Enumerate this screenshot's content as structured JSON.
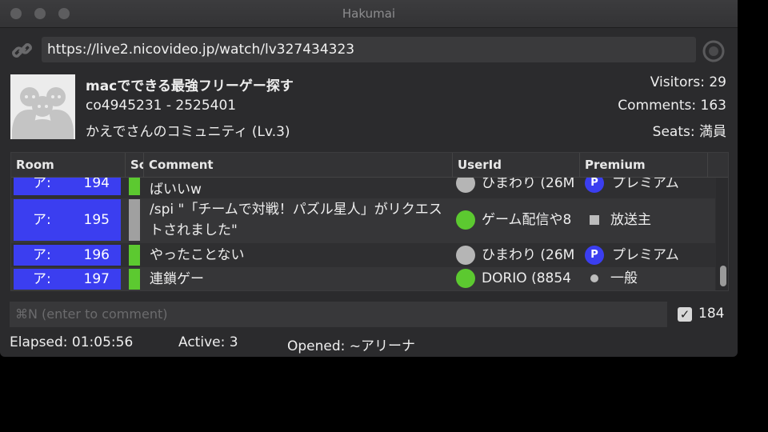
{
  "window": {
    "title": "Hakumai"
  },
  "url": {
    "value": "https://live2.nicovideo.jp/watch/lv327434323"
  },
  "program": {
    "title": "macでできる最強フリーゲー探す",
    "community_id": "co4945231 - 2525401",
    "community_name": "かえでさんのコミュニティ (Lv.3)"
  },
  "stats": {
    "visitors": "Visitors: 29",
    "comments": "Comments: 163",
    "seats": "Seats: 満員"
  },
  "table": {
    "headers": [
      "Room",
      "Sc",
      "Comment",
      "UserId",
      "Premium"
    ],
    "rows": [
      {
        "room_label": "ア:",
        "room_no": "194",
        "score": "green",
        "comment": "ばいいw",
        "user_icon": "grey",
        "user": "ひまわり (26M",
        "premium_icon": "P",
        "premium": "プレミアム"
      },
      {
        "room_label": "ア:",
        "room_no": "195",
        "score": "grey",
        "comment": "/spi \"「チームで対戦！パズル星人」がリクエストされました\"",
        "user_icon": "green",
        "user": "ゲーム配信や8",
        "premium_icon": "square",
        "premium": "放送主"
      },
      {
        "room_label": "ア:",
        "room_no": "196",
        "score": "green",
        "comment": "やったことない",
        "user_icon": "grey",
        "user": "ひまわり (26M",
        "premium_icon": "P",
        "premium": "プレミアム"
      },
      {
        "room_label": "ア:",
        "room_no": "197",
        "score": "green",
        "comment": "連鎖ゲー",
        "user_icon": "green",
        "user": "DORIO (8854",
        "premium_icon": "dot",
        "premium": "一般"
      }
    ]
  },
  "comment_input": {
    "placeholder": "⌘N (enter to comment)"
  },
  "auto_scroll": {
    "checked": true,
    "count": "184"
  },
  "status": {
    "elapsed": "Elapsed: 01:05:56",
    "active": "Active: 3",
    "opened": "Opened: ~アリーナ"
  },
  "colors": {
    "room_bg": "#3b3ef0",
    "score_green": "#5cc930",
    "score_grey": "#a0a0a0",
    "premium_blue": "#3b3ef0"
  }
}
